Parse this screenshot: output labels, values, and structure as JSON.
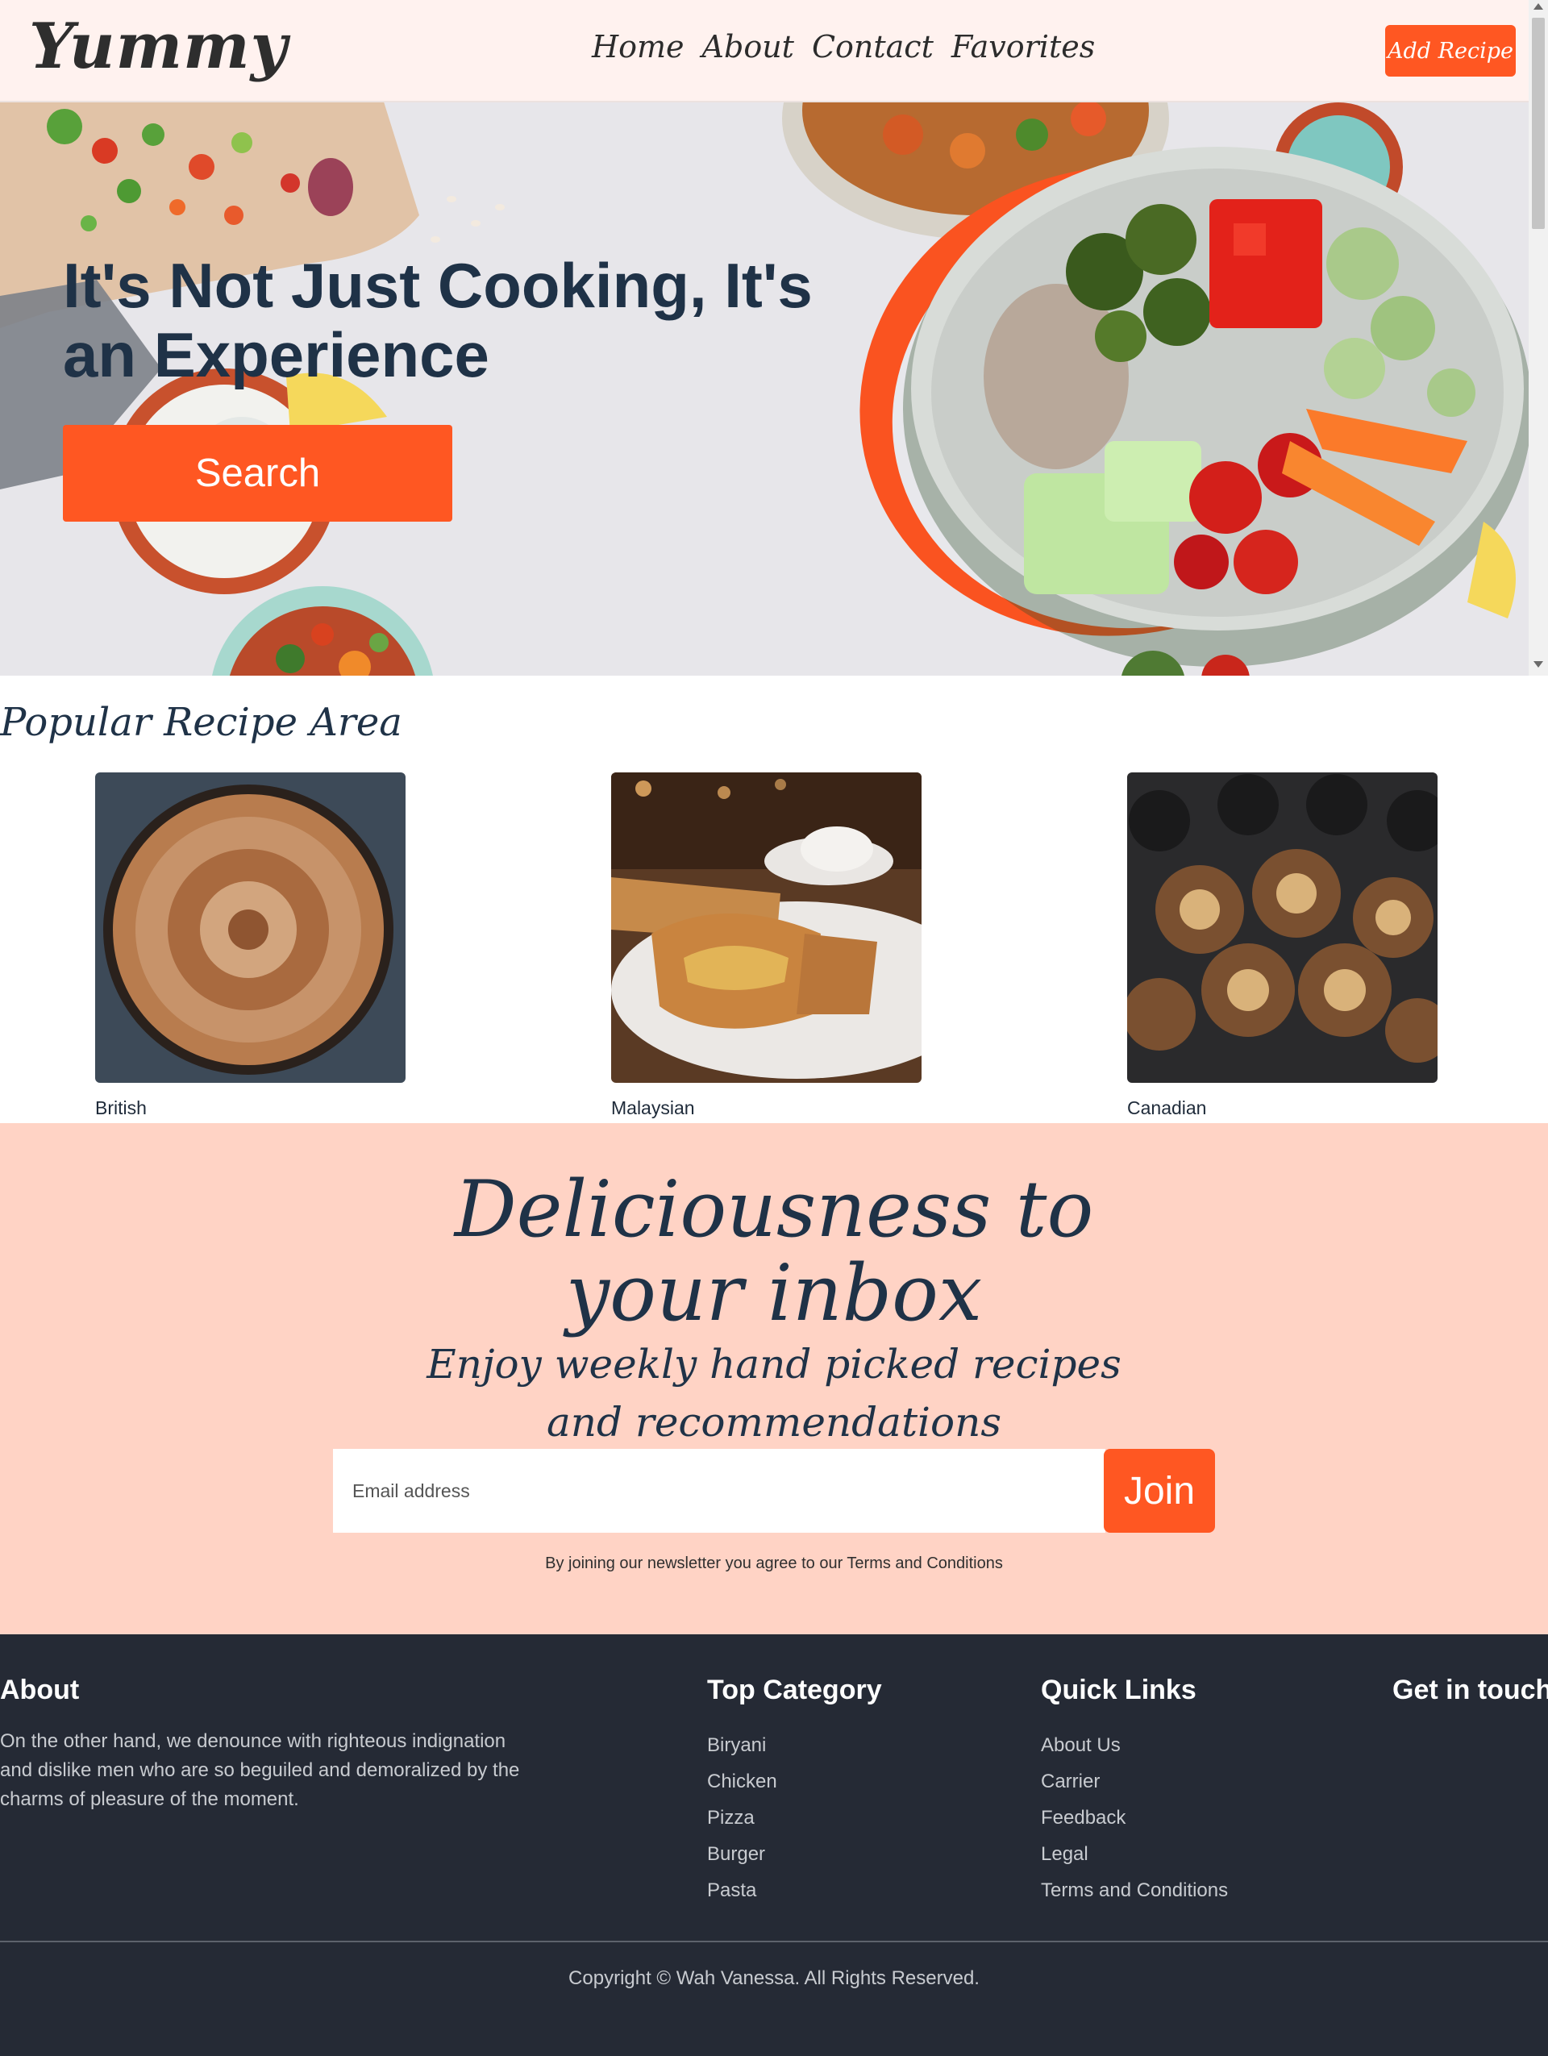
{
  "header": {
    "logo": "Yummy",
    "nav": [
      "Home",
      "About",
      "Contact",
      "Favorites"
    ],
    "add_recipe": "Add Recipe"
  },
  "hero": {
    "title": "It's Not Just Cooking, It's an Experience",
    "search_label": "Search"
  },
  "popular": {
    "title": "Popular Recipe Area",
    "cards": [
      {
        "label": "British"
      },
      {
        "label": "Malaysian"
      },
      {
        "label": "Canadian"
      }
    ]
  },
  "newsletter": {
    "title_line1": "Deliciousness to",
    "title_line2": "your inbox",
    "sub_line1": "Enjoy weekly hand picked recipes",
    "sub_line2": "and recommendations",
    "email_placeholder": "Email address",
    "join_label": "Join",
    "terms": "By joining our newsletter you agree to our Terms and Conditions"
  },
  "footer": {
    "about": {
      "heading": "About",
      "text": "On the other hand, we denounce with righteous indignation and dislike men who are so beguiled and demoralized by the charms of pleasure of the moment."
    },
    "top_category": {
      "heading": "Top Category",
      "items": [
        "Biryani",
        "Chicken",
        "Pizza",
        "Burger",
        "Pasta"
      ]
    },
    "quick_links": {
      "heading": "Quick Links",
      "items": [
        "About Us",
        "Carrier",
        "Feedback",
        "Legal",
        "Terms and Conditions"
      ]
    },
    "get_in_touch": {
      "heading": "Get in touch"
    },
    "copyright": "Copyright © Wah Vanessa. All Rights Reserved."
  },
  "colors": {
    "accent": "#ff5722",
    "nav_bg": "#fff2ef",
    "newsletter_bg": "#ffd3c5",
    "footer_bg": "#252a35",
    "heading": "#1f3247"
  }
}
